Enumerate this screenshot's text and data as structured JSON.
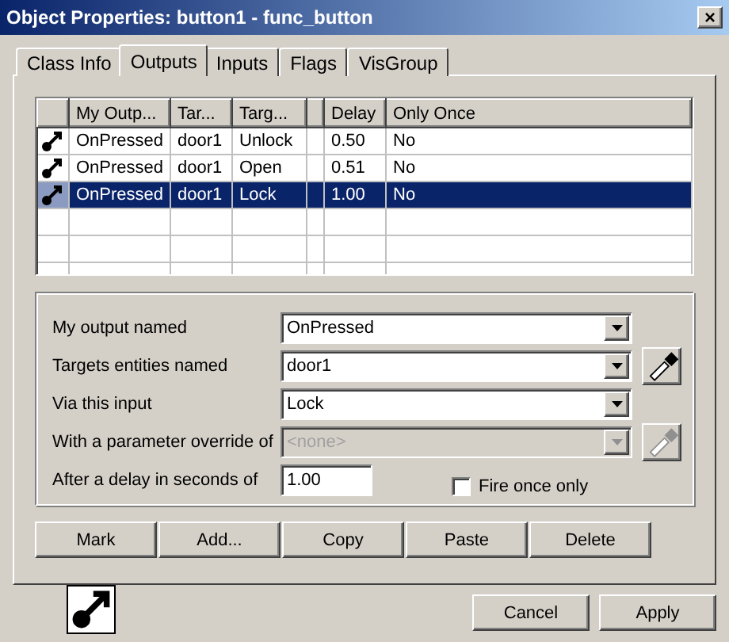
{
  "window": {
    "title": "Object Properties: button1 - func_button",
    "close": "×"
  },
  "tabs": [
    {
      "label": "Class Info",
      "selected": false
    },
    {
      "label": "Outputs",
      "selected": true
    },
    {
      "label": "Inputs",
      "selected": false
    },
    {
      "label": "Flags",
      "selected": false
    },
    {
      "label": "VisGroup",
      "selected": false
    }
  ],
  "table": {
    "columns": [
      "",
      "My Outp...",
      "Tar...",
      "Targ...",
      "",
      "Delay",
      "Only Once"
    ],
    "rows": [
      {
        "output": "OnPressed",
        "target": "door1",
        "input": "Unlock",
        "column_5": "",
        "delay": "0.50",
        "only_once": "No",
        "selected": false
      },
      {
        "output": "OnPressed",
        "target": "door1",
        "input": "Open",
        "column_5": "",
        "delay": "0.51",
        "only_once": "No",
        "selected": false
      },
      {
        "output": "OnPressed",
        "target": "door1",
        "input": "Lock",
        "column_5": "",
        "delay": "1.00",
        "only_once": "No",
        "selected": true
      }
    ]
  },
  "form": {
    "fields": [
      {
        "label": "My output named",
        "value": "OnPressed",
        "kind": "combo",
        "disabled": false,
        "picker": false
      },
      {
        "label": "Targets entities named",
        "value": "door1",
        "kind": "combo",
        "disabled": false,
        "picker": true
      },
      {
        "label": "Via this input",
        "value": "Lock",
        "kind": "combo",
        "disabled": false,
        "picker": false
      },
      {
        "label": "With a parameter override of",
        "value": "<none>",
        "kind": "combo",
        "disabled": true,
        "picker": true
      },
      {
        "label": "After a delay in seconds of",
        "value": "1.00",
        "kind": "text",
        "disabled": false,
        "picker": false
      }
    ],
    "fire_once": {
      "label": "Fire once only",
      "checked": false
    }
  },
  "actions": [
    "Mark",
    "Add...",
    "Copy",
    "Paste",
    "Delete"
  ],
  "footer_buttons": [
    "Cancel",
    "Apply"
  ]
}
